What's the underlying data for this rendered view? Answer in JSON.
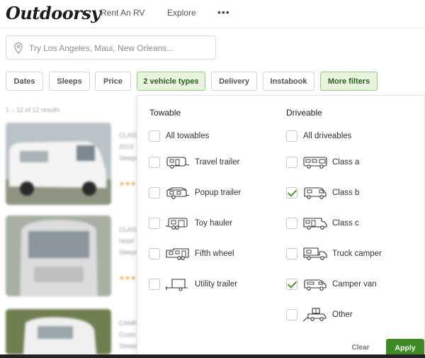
{
  "header": {
    "logo": "Outdoorsy",
    "nav": {
      "rent": "Rent An RV",
      "explore": "Explore",
      "more": "•••"
    }
  },
  "search": {
    "placeholder": "Try Los Angeles, Maui, New Orleans..."
  },
  "filters": {
    "dates": "Dates",
    "sleeps": "Sleeps",
    "price": "Price",
    "vehicle_types": "2 vehicle types",
    "delivery": "Delivery",
    "instabook": "Instabook",
    "more_filters": "More filters"
  },
  "results": {
    "count": "1 – 12 of 12 results",
    "cards": [
      {
        "type": "CLASS B",
        "title": "2019",
        "sub": "Sleeps",
        "stars": "★★★"
      },
      {
        "type": "CLASS B",
        "title": "Hotel",
        "sub": "Sleeps",
        "stars": "★★★"
      },
      {
        "type": "CAMPER",
        "title": "Custo",
        "sub": "Sleeps",
        "stars": ""
      }
    ]
  },
  "vehicle_panel": {
    "towable": {
      "title": "Towable",
      "all": {
        "label": "All towables",
        "checked": false
      },
      "options": [
        {
          "label": "Travel trailer",
          "checked": false,
          "icon": "travel-trailer-icon"
        },
        {
          "label": "Popup trailer",
          "checked": false,
          "icon": "popup-trailer-icon"
        },
        {
          "label": "Toy hauler",
          "checked": false,
          "icon": "toy-hauler-icon"
        },
        {
          "label": "Fifth wheel",
          "checked": false,
          "icon": "fifth-wheel-icon"
        },
        {
          "label": "Utility trailer",
          "checked": false,
          "icon": "utility-trailer-icon"
        }
      ]
    },
    "driveable": {
      "title": "Driveable",
      "all": {
        "label": "All driveables",
        "checked": false
      },
      "options": [
        {
          "label": "Class a",
          "checked": false,
          "icon": "class-a-icon"
        },
        {
          "label": "Class b",
          "checked": true,
          "icon": "class-b-icon"
        },
        {
          "label": "Class c",
          "checked": false,
          "icon": "class-c-icon"
        },
        {
          "label": "Truck camper",
          "checked": false,
          "icon": "truck-camper-icon"
        },
        {
          "label": "Camper van",
          "checked": true,
          "icon": "camper-van-icon"
        },
        {
          "label": "Other",
          "checked": false,
          "icon": "other-vehicle-icon"
        }
      ]
    },
    "clear": "Clear",
    "apply": "Apply"
  },
  "colors": {
    "accent": "#3f8a24",
    "chip_active_bg": "#e8f4de",
    "check": "#4a9a2e"
  }
}
